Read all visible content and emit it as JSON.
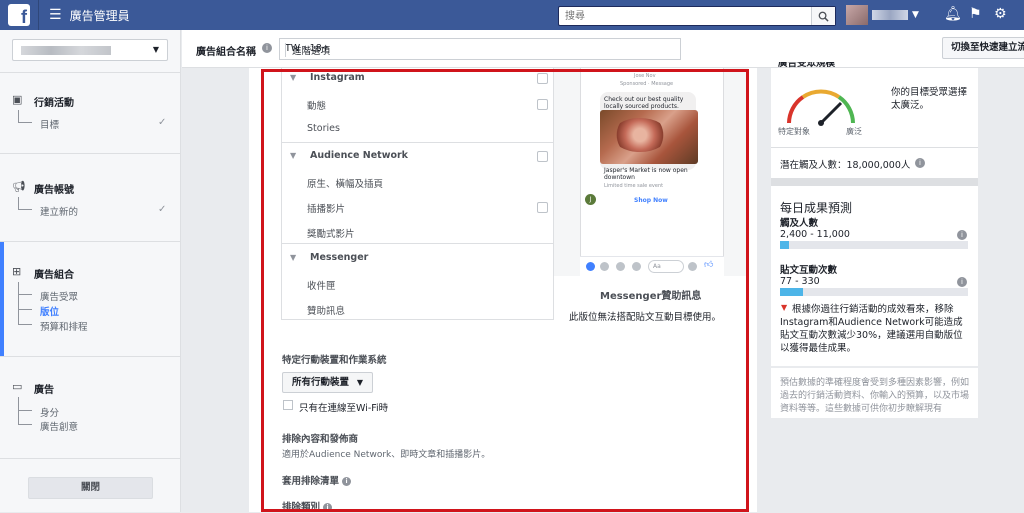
{
  "topbar": {
    "app_title": "廣告管理員",
    "search_placeholder": "搜尋",
    "colors": {
      "bar": "#3b5998"
    }
  },
  "left_nav": {
    "sections": [
      {
        "title": "行銷活動",
        "icon": "campaign-icon",
        "subs": [
          "目標"
        ]
      },
      {
        "title": "廣告帳號",
        "icon": "megaphone-icon",
        "subs": [
          "建立新的"
        ]
      },
      {
        "title": "廣告組合",
        "icon": "adset-icon",
        "subs": [
          "廣告受眾",
          "版位",
          "預算和排程"
        ]
      },
      {
        "title": "廣告",
        "icon": "ad-icon",
        "subs": [
          "身分",
          "廣告創意"
        ]
      }
    ],
    "close_label": "關閉"
  },
  "header": {
    "adset_name_label": "廣告組合名稱",
    "adset_name_value": "TW - 18+",
    "advanced_options": "進階選項",
    "quick_create": "切換至快速建立流"
  },
  "placements": {
    "groups": [
      {
        "title": "Instagram",
        "items": [
          "動態",
          "Stories"
        ]
      },
      {
        "title": "Audience Network",
        "items": [
          "原生、橫幅及插頁",
          "插播影片",
          "獎勵式影片"
        ]
      },
      {
        "title": "Messenger",
        "items": [
          "收件匣",
          "贊助訊息"
        ]
      }
    ]
  },
  "preview": {
    "header_line1": "Jose Nov",
    "header_line2": "Sponsored · Message",
    "bubble_text": "Check out our best quality locally sourced products.",
    "product_title": "Jasper's Market is now open downtown",
    "product_sub": "Limited time sale event",
    "cta": "Shop Now",
    "composer_placeholder": "Aa",
    "caption_title": "Messenger贊助訊息",
    "caption_sub": "此版位無法搭配貼文互動目標使用。"
  },
  "devices": {
    "title": "特定行動裝置和作業系統",
    "select_value": "所有行動裝置",
    "wifi_label": "只有在連線至Wi-Fi時"
  },
  "exclusions": {
    "title": "排除內容和發佈商",
    "subtitle": "適用於Audience Network、即時文章和插播影片。",
    "blocklist": "套用排除清單",
    "categories": "排除類別"
  },
  "audience_size": {
    "heading": "廣告受眾規模",
    "verdict": "你的目標受眾選擇太廣泛。",
    "gauge_left": "特定對象",
    "gauge_right": "廣泛",
    "potential_reach": "潛在觸及人數：18,000,000人"
  },
  "daily_estimate": {
    "title": "每日成果預測",
    "reach_label": "觸及人數",
    "reach_value": "2,400 - 11,000",
    "reach_fill": 0.05,
    "engage_label": "貼文互動次數",
    "engage_value": "77 - 330",
    "engage_fill": 0.12,
    "advice": "根據你過往行銷活動的成效看來，移除Instagram和Audience Network可能造成貼文互動次數減少30%，建議選用自動版位以獲得最佳成果。",
    "footnote": "預估數據的準確程度會受到多種因素影響，例如過去的行銷活動資料、你輸入的預算，以及市場資料等等。這些數據可供你初步瞭解現有"
  }
}
